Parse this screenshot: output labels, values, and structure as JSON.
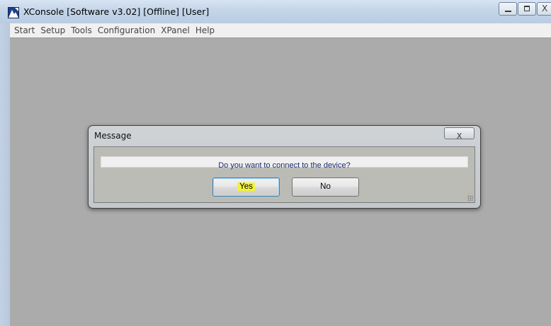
{
  "window": {
    "title": "XConsole [Software v3.02] [Offline] [User]",
    "controls": {
      "close_glyph": "X"
    }
  },
  "menu": {
    "items": [
      "Start",
      "Setup",
      "Tools",
      "Configuration",
      "XPanel",
      "Help"
    ]
  },
  "dialog": {
    "title": "Message",
    "close_glyph": "X",
    "message": "Do you want to connect to the device?",
    "yes_label": "Yes",
    "no_label": "No",
    "highlight_color": "#f2f23c"
  },
  "icons": {
    "app": "app-icon",
    "minimize": "minimize-icon",
    "maximize": "maximize-icon",
    "close": "close-icon",
    "resize": "resize-grip-icon"
  }
}
